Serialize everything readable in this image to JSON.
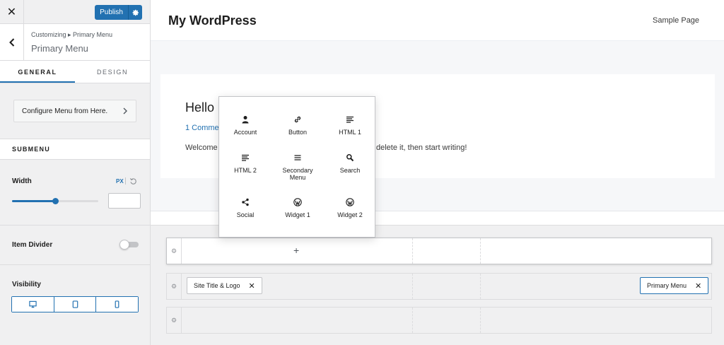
{
  "sidebar": {
    "close_label": "✕",
    "publish_label": "Publish",
    "breadcrumb": "Customizing ▸ Primary Menu",
    "title": "Primary Menu",
    "tabs": [
      {
        "label": "GENERAL",
        "active": true
      },
      {
        "label": "DESIGN",
        "active": false
      }
    ],
    "configure_label": "Configure Menu from Here.",
    "submenu_heading": "SUBMENU",
    "width_label": "Width",
    "width_unit": "PX",
    "width_value": "",
    "slider_fraction": 0.5,
    "item_divider_label": "Item Divider",
    "item_divider_on": false,
    "visibility_label": "Visibility",
    "accent_color": "#2271b1"
  },
  "preview": {
    "site_title": "My WordPress",
    "nav_link": "Sample Page",
    "post_title": "Hello",
    "post_comments": "1 Comme",
    "post_text_a": "Welcome",
    "post_text_b": "delete it, then start writing!"
  },
  "builder": {
    "add_symbol": "+",
    "site_title_chip": "Site Title & Logo",
    "primary_menu_chip": "Primary Menu",
    "remove_symbol": "✕"
  },
  "popup": {
    "items": [
      {
        "label": "Account",
        "icon": "account-icon"
      },
      {
        "label": "Button",
        "icon": "link-icon"
      },
      {
        "label": "HTML 1",
        "icon": "text-lines-icon"
      },
      {
        "label": "HTML 2",
        "icon": "text-lines-icon"
      },
      {
        "label": "Secondary Menu",
        "icon": "menu-icon"
      },
      {
        "label": "Search",
        "icon": "search-icon"
      },
      {
        "label": "Social",
        "icon": "share-icon"
      },
      {
        "label": "Widget 1",
        "icon": "wordpress-icon"
      },
      {
        "label": "Widget 2",
        "icon": "wordpress-icon"
      }
    ]
  }
}
